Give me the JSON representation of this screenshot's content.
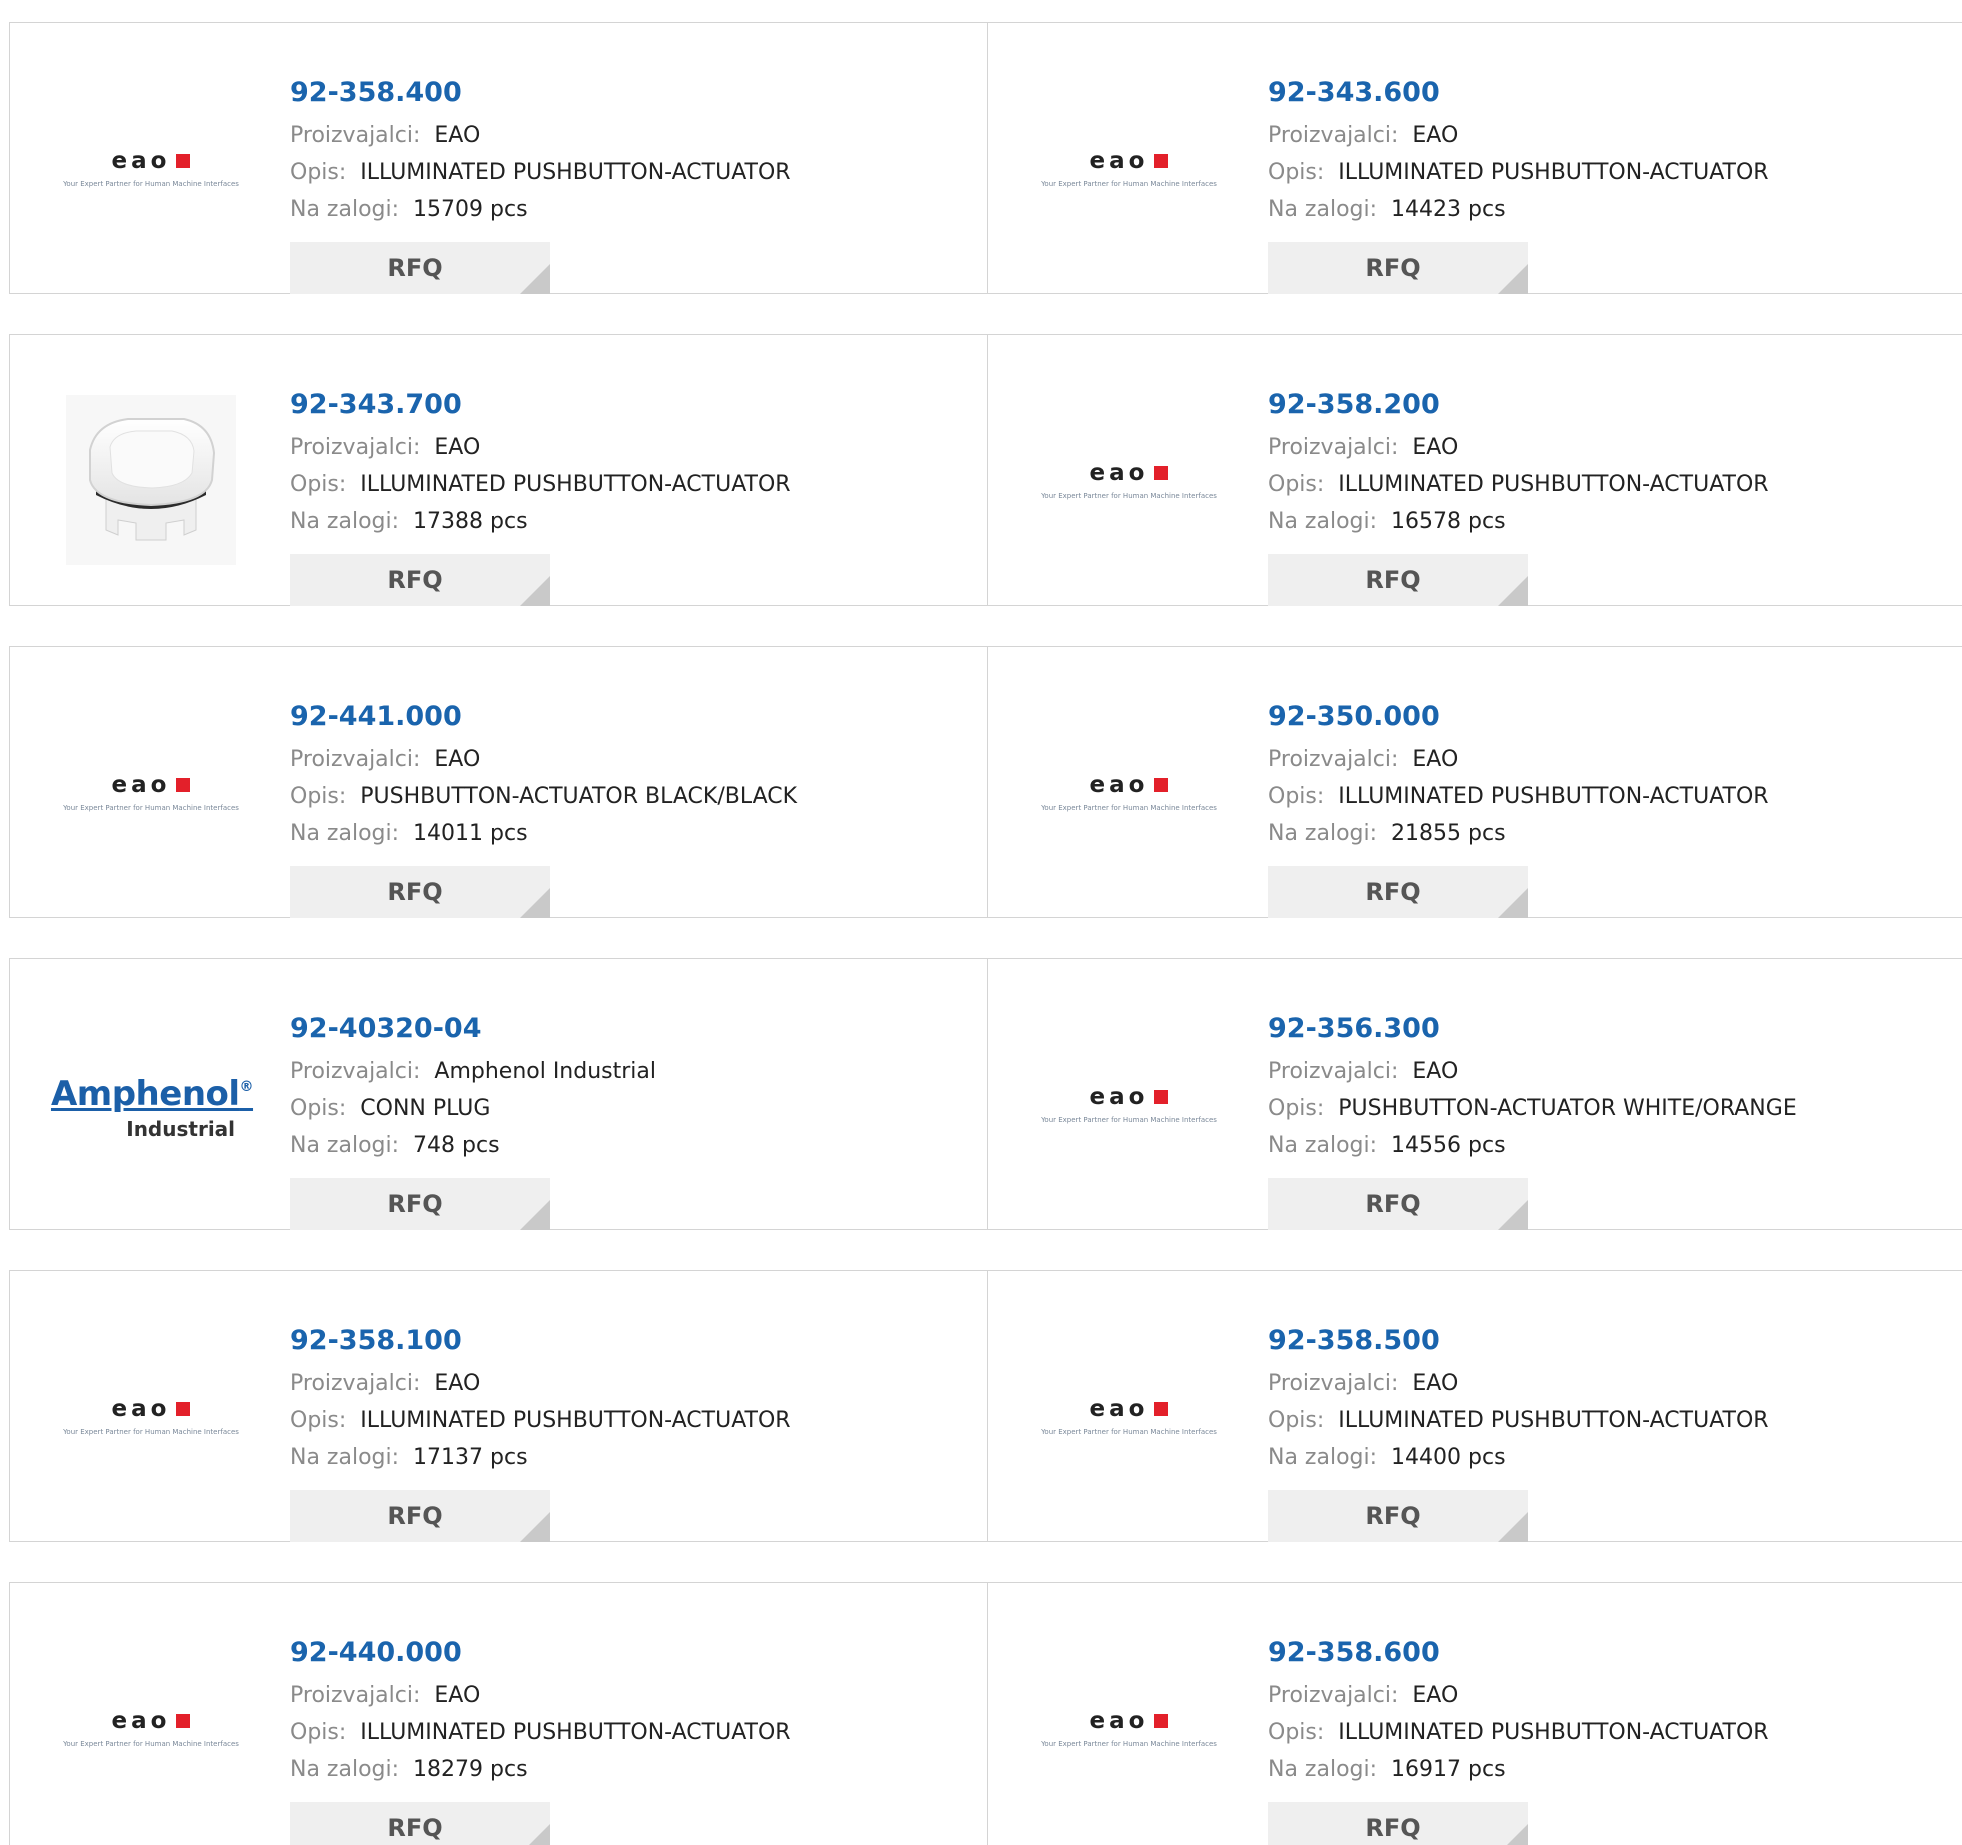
{
  "labels": {
    "manufacturer": "Proizvajalci:",
    "description": "Opis:",
    "stock": "Na zalogi:",
    "rfq": "RFQ",
    "eao_brand": "eao",
    "eao_tagline": "Your Expert Partner for Human Machine Interfaces",
    "amphenol_brand": "Amphenol",
    "amphenol_reg": "®",
    "amphenol_sub": "Industrial"
  },
  "colors": {
    "part_link": "#1a64ad",
    "eao_red": "#e3202a",
    "amphenol_blue": "#1b5fa8",
    "rfq_bg": "#efefef"
  },
  "products": [
    {
      "part": "92-358.400",
      "manufacturer": "EAO",
      "description": "ILLUMINATED PUSHBUTTON-ACTUATOR",
      "stock": "15709 pcs",
      "logo": "eao-logo"
    },
    {
      "part": "92-343.600",
      "manufacturer": "EAO",
      "description": "ILLUMINATED PUSHBUTTON-ACTUATOR",
      "stock": "14423 pcs",
      "logo": "eao-logo"
    },
    {
      "part": "92-343.700",
      "manufacturer": "EAO",
      "description": "ILLUMINATED PUSHBUTTON-ACTUATOR",
      "stock": "17388 pcs",
      "logo": "product-photo"
    },
    {
      "part": "92-358.200",
      "manufacturer": "EAO",
      "description": "ILLUMINATED PUSHBUTTON-ACTUATOR",
      "stock": "16578 pcs",
      "logo": "eao-logo"
    },
    {
      "part": "92-441.000",
      "manufacturer": "EAO",
      "description": "PUSHBUTTON-ACTUATOR BLACK/BLACK",
      "stock": "14011 pcs",
      "logo": "eao-logo"
    },
    {
      "part": "92-350.000",
      "manufacturer": "EAO",
      "description": "ILLUMINATED PUSHBUTTON-ACTUATOR",
      "stock": "21855 pcs",
      "logo": "eao-logo"
    },
    {
      "part": "92-40320-04",
      "manufacturer": "Amphenol Industrial",
      "description": "CONN PLUG",
      "stock": "748 pcs",
      "logo": "amphenol-logo"
    },
    {
      "part": "92-356.300",
      "manufacturer": "EAO",
      "description": "PUSHBUTTON-ACTUATOR WHITE/ORANGE",
      "stock": "14556 pcs",
      "logo": "eao-logo"
    },
    {
      "part": "92-358.100",
      "manufacturer": "EAO",
      "description": "ILLUMINATED PUSHBUTTON-ACTUATOR",
      "stock": "17137 pcs",
      "logo": "eao-logo"
    },
    {
      "part": "92-358.500",
      "manufacturer": "EAO",
      "description": "ILLUMINATED PUSHBUTTON-ACTUATOR",
      "stock": "14400 pcs",
      "logo": "eao-logo"
    },
    {
      "part": "92-440.000",
      "manufacturer": "EAO",
      "description": "ILLUMINATED PUSHBUTTON-ACTUATOR",
      "stock": "18279 pcs",
      "logo": "eao-logo"
    },
    {
      "part": "92-358.600",
      "manufacturer": "EAO",
      "description": "ILLUMINATED PUSHBUTTON-ACTUATOR",
      "stock": "16917 pcs",
      "logo": "eao-logo"
    }
  ]
}
